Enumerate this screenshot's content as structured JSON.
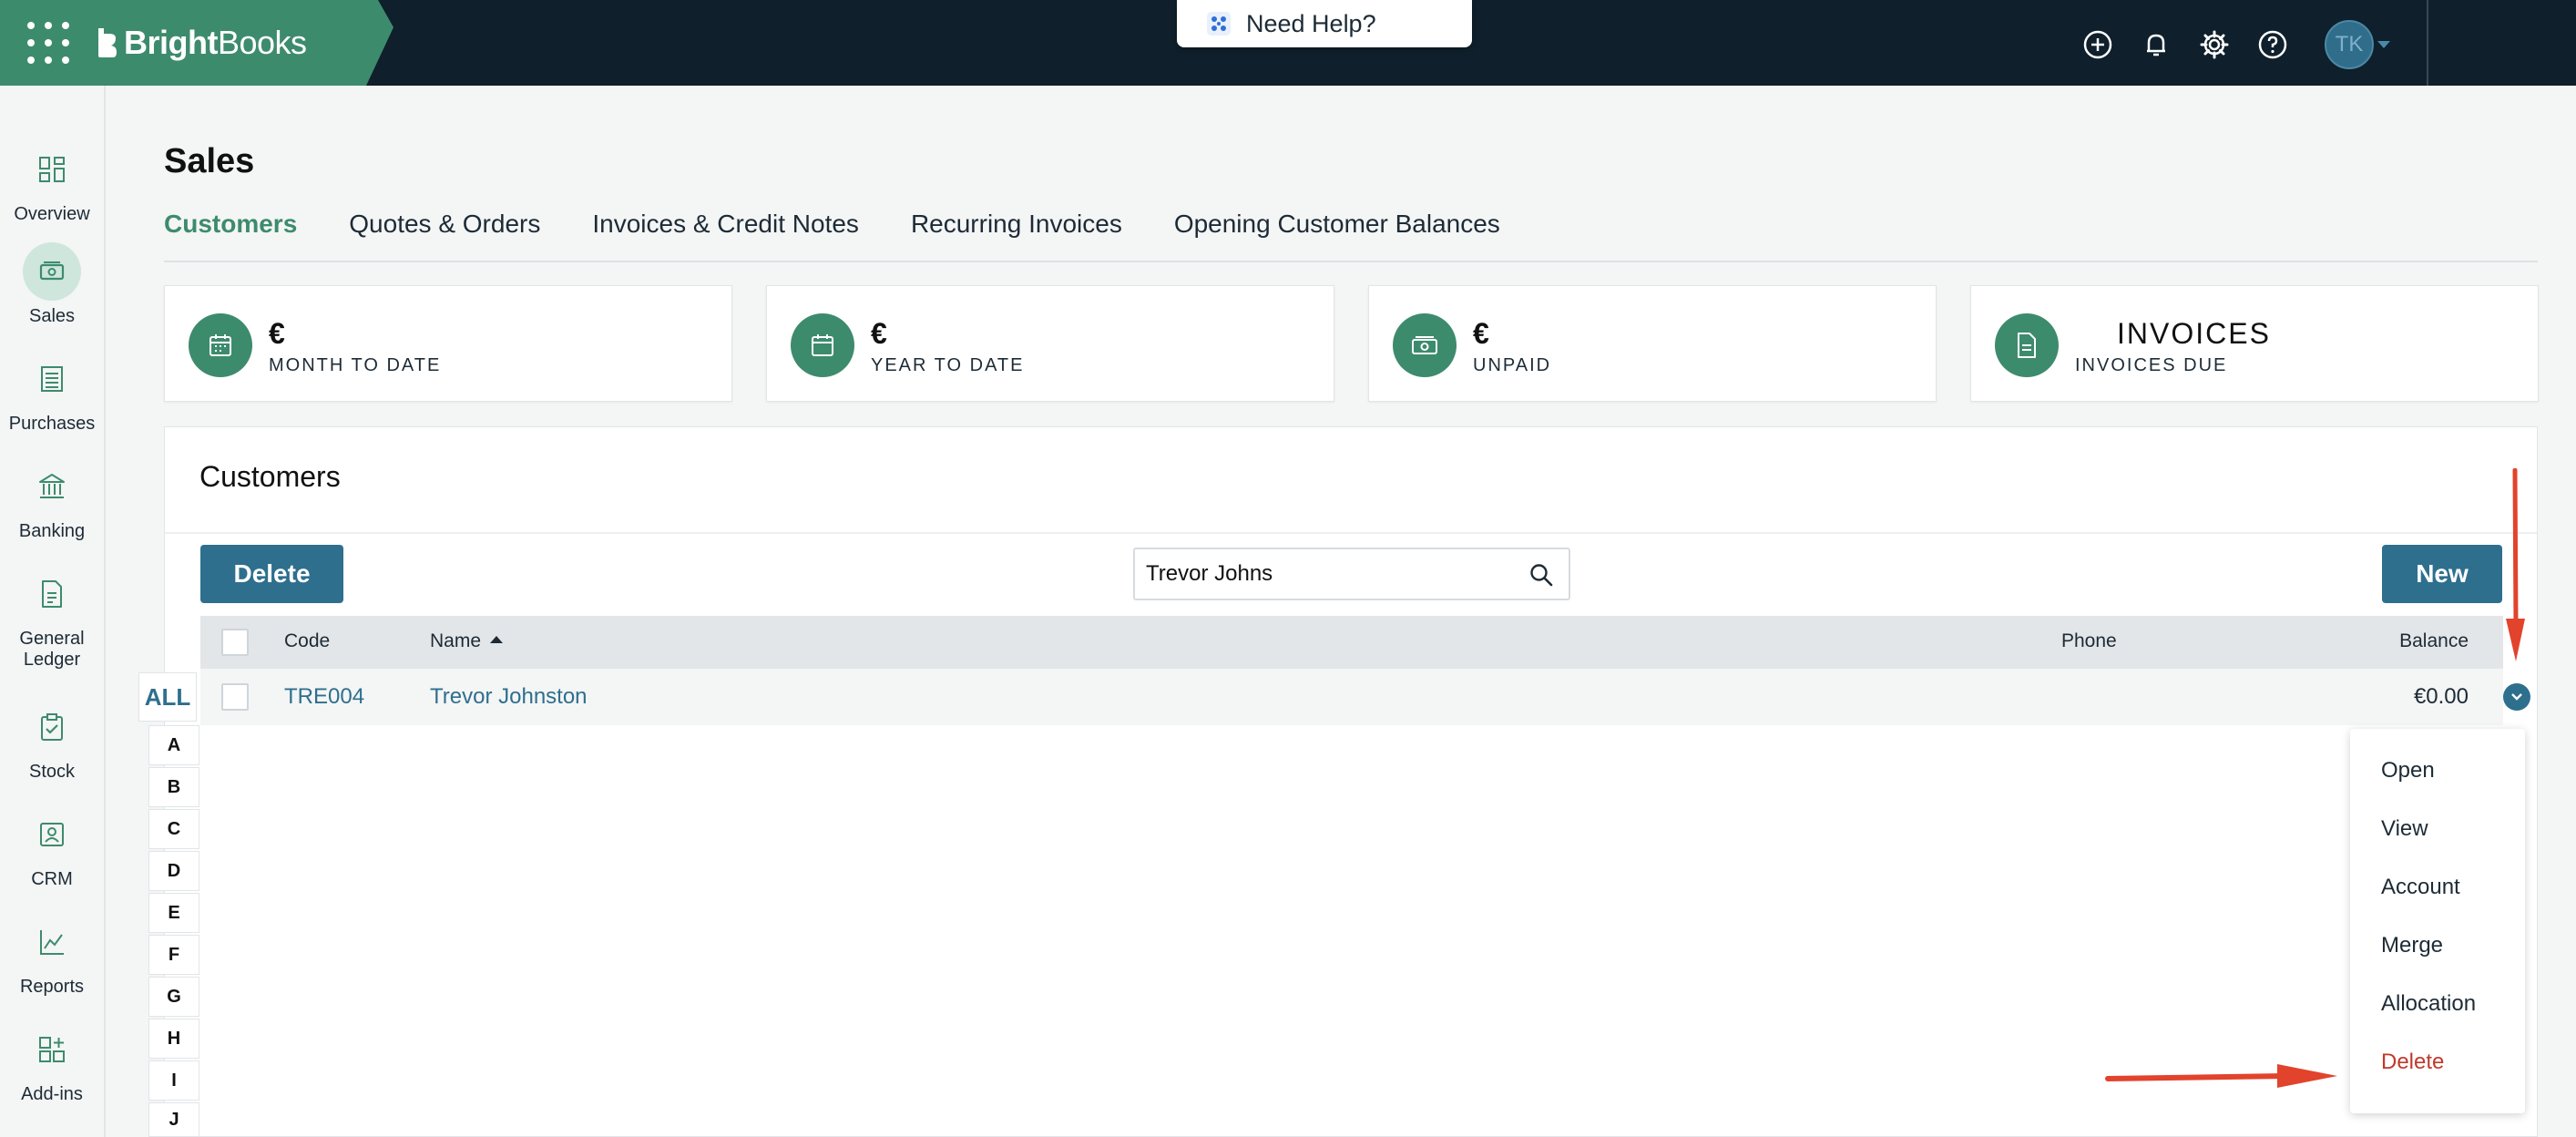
{
  "topbar": {
    "brand_bold": "Bright",
    "brand_light": "Books",
    "help_label": "Need Help?",
    "avatar_initials": "TK"
  },
  "sidebar": {
    "items": [
      {
        "label": "Overview",
        "icon": "overview-icon"
      },
      {
        "label": "Sales",
        "icon": "sales-icon",
        "active": true
      },
      {
        "label": "Purchases",
        "icon": "purchases-icon"
      },
      {
        "label": "Banking",
        "icon": "banking-icon"
      },
      {
        "label": "General",
        "label2": "Ledger",
        "icon": "ledger-icon"
      },
      {
        "label": "Stock",
        "icon": "stock-icon"
      },
      {
        "label": "CRM",
        "icon": "crm-icon"
      },
      {
        "label": "Reports",
        "icon": "reports-icon"
      },
      {
        "label": "Add-ins",
        "icon": "addins-icon"
      }
    ]
  },
  "page": {
    "title": "Sales",
    "tabs": [
      "Customers",
      "Quotes & Orders",
      "Invoices & Credit Notes",
      "Recurring Invoices",
      "Opening Customer Balances"
    ]
  },
  "kpis": [
    {
      "value": "€",
      "label": "MONTH TO DATE",
      "icon": "calendar-icon"
    },
    {
      "value": "€",
      "label": "YEAR TO DATE",
      "icon": "calendar-icon"
    },
    {
      "value": "€",
      "label": "UNPAID",
      "icon": "money-icon"
    },
    {
      "value": "INVOICES",
      "label": "INVOICES DUE",
      "icon": "document-icon"
    }
  ],
  "customers": {
    "title": "Customers",
    "delete_label": "Delete",
    "new_label": "New",
    "search_value": "Trevor Johns",
    "columns": {
      "code": "Code",
      "name": "Name",
      "phone": "Phone",
      "balance": "Balance"
    },
    "rows": [
      {
        "code": "TRE004",
        "name": "Trevor Johnston",
        "phone": "",
        "balance": "€0.00"
      }
    ],
    "alpha_all": "ALL",
    "alpha": [
      "A",
      "B",
      "C",
      "D",
      "E",
      "F",
      "G",
      "H",
      "I",
      "J"
    ]
  },
  "row_menu": [
    "Open",
    "View",
    "Account",
    "Merge",
    "Allocation",
    "Delete"
  ],
  "colors": {
    "brand_green": "#3d8b6d",
    "topbar_bg": "#0f1f2b",
    "button_blue": "#2e6f8e",
    "annotation_red": "#e2432c",
    "danger_text": "#c0392b"
  }
}
